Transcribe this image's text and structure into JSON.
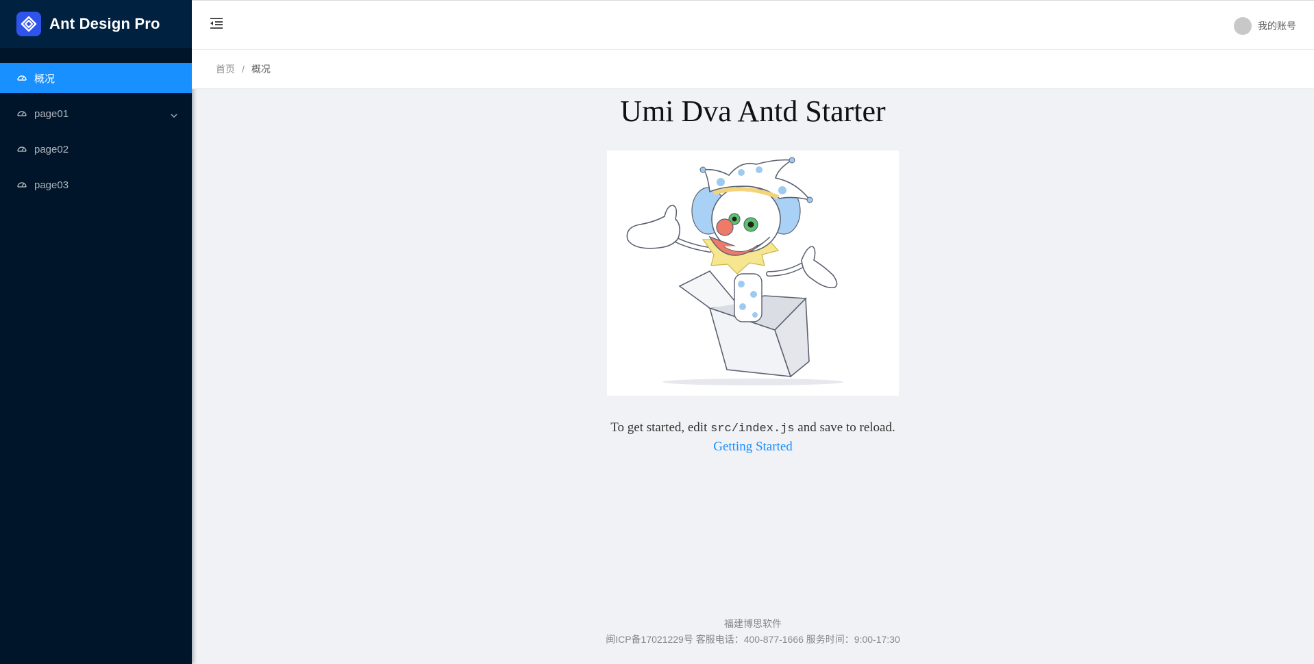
{
  "app": {
    "title": "Ant Design Pro",
    "brand_color": "#2f54eb"
  },
  "sidebar": {
    "background": "#001529",
    "items": [
      {
        "label": "概况",
        "icon": "dashboard-icon",
        "active": true
      },
      {
        "label": "page01",
        "icon": "dashboard-icon",
        "has_submenu": true
      },
      {
        "label": "page02",
        "icon": "dashboard-icon"
      },
      {
        "label": "page03",
        "icon": "dashboard-icon"
      }
    ]
  },
  "header": {
    "trigger_icon": "menu-fold-icon",
    "account_name": "我的账号"
  },
  "breadcrumb": {
    "home": "首页",
    "separator": "/",
    "current": "概况"
  },
  "main": {
    "title": "Umi Dva Antd Starter",
    "illustration": "jack-in-the-box-clown",
    "hint_before": "To get started, edit ",
    "hint_code": "src/index.js",
    "hint_after": " and save to reload.",
    "link_label": "Getting Started",
    "link_color": "#1890ff"
  },
  "footer": {
    "company": "福建博思软件",
    "info": "闽ICP备17021229号 客服电话：400-877-1666 服务时间：9:00-17:30"
  }
}
